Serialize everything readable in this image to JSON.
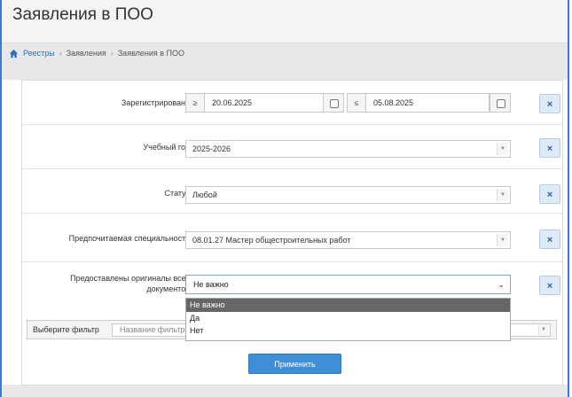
{
  "page": {
    "title": "Заявления в ПОО"
  },
  "breadcrumb": {
    "items": [
      "Реестры",
      "Заявления",
      "Заявления в ПОО"
    ]
  },
  "filters": {
    "registered": {
      "label": "Зарегистрировано",
      "from_prefix": "≥",
      "from_value": "20.06.2025",
      "to_prefix": "≤",
      "to_value": "05.08.2025"
    },
    "academic_year": {
      "label": "Учебный год",
      "value": "2025-2026"
    },
    "status": {
      "label": "Статус",
      "value": "Любой"
    },
    "specialty": {
      "label": "Предпочитаемая специальность",
      "value": "08.01.27 Мастер общестроительных работ"
    },
    "originals": {
      "label_line1": "Предоставлены оригиналы всех",
      "label_line2": "документов",
      "value": "Не важно",
      "options": [
        "Не важно",
        "Да",
        "Нет"
      ]
    },
    "clear_label": "×"
  },
  "filter_picker": {
    "label": "Выберите фильтр",
    "placeholder": "Название фильтра"
  },
  "apply_label": "Применить",
  "colors": {
    "accent": "#3f8fd8",
    "frame": "#3a7bd5",
    "clear_button_bg": "#dfeaf7"
  }
}
